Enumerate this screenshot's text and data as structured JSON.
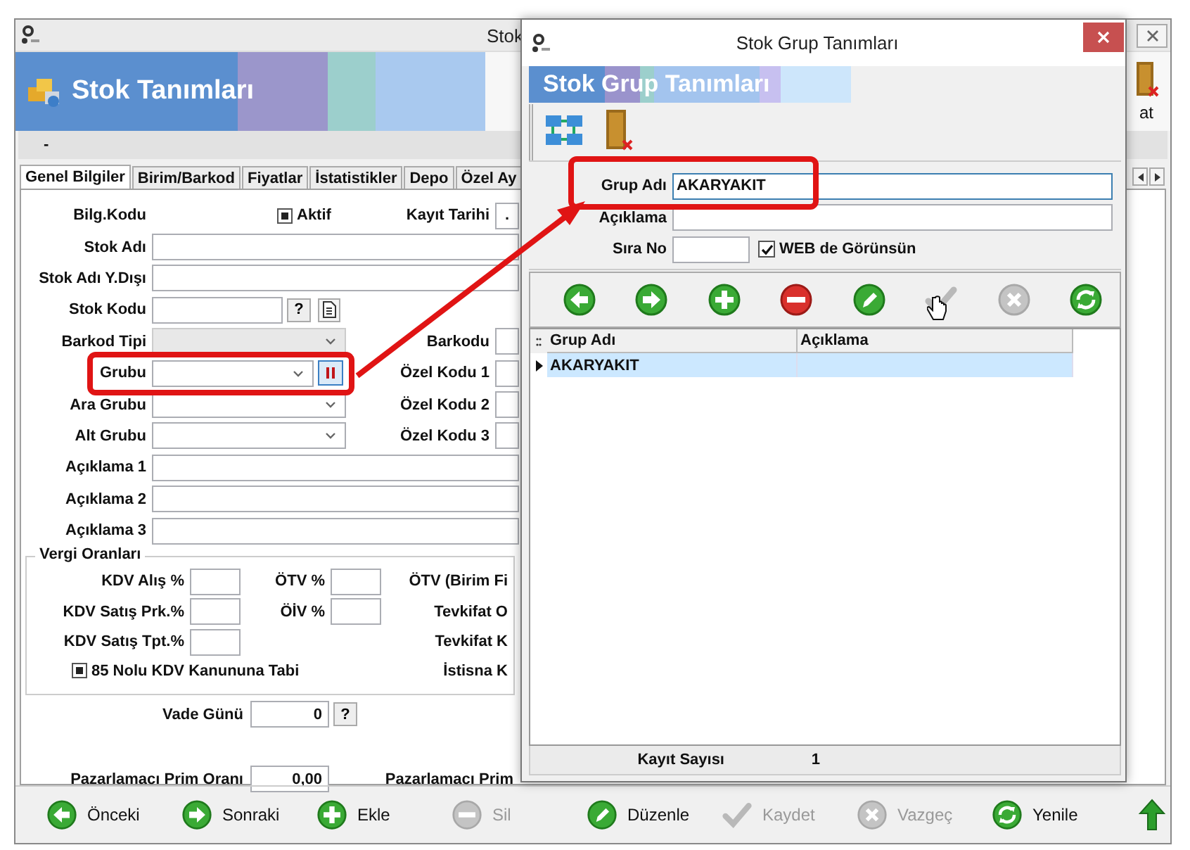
{
  "main_window": {
    "title": "Stok",
    "header_title": "Stok Tanımları",
    "header_button_label": "at",
    "strip_label": "-",
    "tabs": [
      {
        "label": "Genel Bilgiler",
        "selected": true
      },
      {
        "label": "Birim/Barkod",
        "selected": false
      },
      {
        "label": "Fiyatlar",
        "selected": false
      },
      {
        "label": "İstatistikler",
        "selected": false
      },
      {
        "label": "Depo",
        "selected": false
      },
      {
        "label": "Özel Ay",
        "selected": false
      }
    ],
    "rows": [
      {
        "kind": "header",
        "label": "Bilg.Kodu",
        "checkbox": {
          "label": "Aktif",
          "checked": true
        },
        "right_label": "Kayıt Tarihi",
        "right_value": "."
      },
      {
        "kind": "text",
        "label": "Stok Adı"
      },
      {
        "kind": "text",
        "label": "Stok Adı Y.Dışı"
      },
      {
        "kind": "code",
        "label": "Stok Kodu",
        "help": "?"
      },
      {
        "kind": "combo",
        "label": "Barkod Tipi",
        "disabled": true,
        "lookup": false,
        "right_label": "Barkodu"
      },
      {
        "kind": "combo",
        "label": "Grubu",
        "disabled": false,
        "lookup": true,
        "right_label": "Özel Kodu 1"
      },
      {
        "kind": "combo",
        "label": "Ara Grubu",
        "disabled": false,
        "lookup": false,
        "right_label": "Özel Kodu 2"
      },
      {
        "kind": "combo",
        "label": "Alt Grubu",
        "disabled": false,
        "lookup": false,
        "right_label": "Özel Kodu 3"
      },
      {
        "kind": "text",
        "label": "Açıklama 1"
      },
      {
        "kind": "text",
        "label": "Açıklama 2"
      },
      {
        "kind": "text",
        "label": "Açıklama 3"
      }
    ],
    "tax": {
      "legend": "Vergi Oranları",
      "rows": [
        {
          "label": "KDV Alış %",
          "mid_label": "ÖTV %",
          "right_label": "ÖTV (Birim Fi"
        },
        {
          "label": "KDV Satış Prk.%",
          "mid_label": "ÖİV %",
          "right_label": "Tevkifat O"
        },
        {
          "label": "KDV Satış Tpt.%",
          "right_label": "Tevkifat K"
        }
      ],
      "checkbox": {
        "label": "85 Nolu KDV Kanununa Tabi",
        "checked": true
      },
      "checkbox_right_label": "İstisna K"
    },
    "vade": {
      "label": "Vade Günü",
      "value": "0",
      "help": "?"
    },
    "prim": {
      "label": "Pazarlamacı Prim Oranı",
      "value": "0,00",
      "right_label": "Pazarlamacı Prim"
    },
    "toolbar": [
      {
        "kind": "prev",
        "label": "Önceki",
        "disabled": false
      },
      {
        "kind": "next",
        "label": "Sonraki",
        "disabled": false
      },
      {
        "kind": "add",
        "label": "Ekle",
        "disabled": false
      },
      {
        "kind": "delete",
        "label": "Sil",
        "disabled": true
      },
      {
        "kind": "edit",
        "label": "Düzenle",
        "disabled": false
      },
      {
        "kind": "save",
        "label": "Kaydet",
        "disabled": true
      },
      {
        "kind": "cancel",
        "label": "Vazgeç",
        "disabled": true
      },
      {
        "kind": "refresh",
        "label": "Yenile",
        "disabled": false
      },
      {
        "kind": "up",
        "disabled": false
      }
    ]
  },
  "dialog": {
    "title": "Stok Grup Tanımları",
    "header_title": "Stok Grup Tanımları",
    "fields": [
      {
        "label": "Grup Adı",
        "value": "AKARYAKIT",
        "focused": true
      },
      {
        "label": "Açıklama",
        "focused": false
      },
      {
        "label": "Sıra No",
        "focused": false,
        "checkbox": {
          "label": "WEB de Görünsün",
          "checked": true
        }
      }
    ],
    "buttons": [
      {
        "kind": "prev",
        "disabled": false
      },
      {
        "kind": "next",
        "disabled": false
      },
      {
        "kind": "add",
        "disabled": false
      },
      {
        "kind": "delete",
        "disabled": false
      },
      {
        "kind": "edit",
        "disabled": false
      },
      {
        "kind": "save",
        "disabled": true
      },
      {
        "kind": "cancel",
        "disabled": true
      },
      {
        "kind": "refresh",
        "disabled": false
      }
    ],
    "grid": {
      "columns": [
        "Grup Adı",
        "Açıklama"
      ],
      "rows": [
        {
          "cells": [
            "AKARYAKIT"
          ],
          "selected": true
        }
      ]
    },
    "footer": {
      "label": "Kayıt Sayısı",
      "value": "1"
    }
  }
}
